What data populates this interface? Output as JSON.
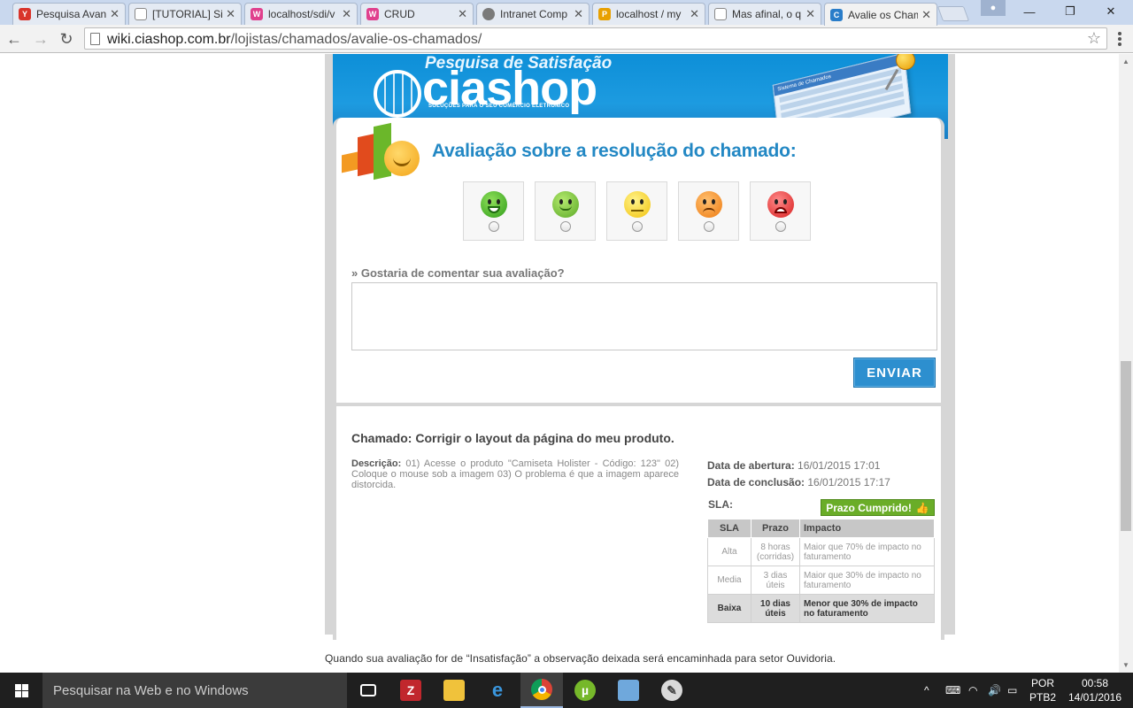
{
  "browser": {
    "tabs": [
      {
        "label": "Pesquisa Avan",
        "favicon_color": "#d9342b",
        "favicon_glyph": "Y"
      },
      {
        "label": "[TUTORIAL] Sis",
        "favicon_color": "#8a8a8a",
        "favicon_glyph": ""
      },
      {
        "label": "localhost/sdi/v",
        "favicon_color": "#e0408d",
        "favicon_glyph": "W"
      },
      {
        "label": "CRUD",
        "favicon_color": "#e0408d",
        "favicon_glyph": "W"
      },
      {
        "label": "Intranet Comp",
        "favicon_color": "#7a7a7a",
        "favicon_glyph": ""
      },
      {
        "label": "localhost / my",
        "favicon_color": "#e8a000",
        "favicon_glyph": "P"
      },
      {
        "label": "Mas afinal, o q",
        "favicon_color": "#8a8a8a",
        "favicon_glyph": ""
      },
      {
        "label": "Avalie os Cham",
        "favicon_color": "#2a7dc9",
        "favicon_glyph": "C"
      }
    ],
    "url_host": "wiki.ciashop.com.br",
    "url_path": "/lojistas/chamados/avalie-os-chamados/"
  },
  "page": {
    "banner": {
      "survey_title": "Pesquisa de Satisfação",
      "brand": "ciashop",
      "tagline": "SOLUÇÕES PARA O SEU COMÉRCIO ELETRÔNICO",
      "mock_header": "Sistema de Chamados"
    },
    "title": "Avaliação sobre a resolução do chamado:",
    "ratings": [
      {
        "name": "very-happy",
        "color": "#43b02a"
      },
      {
        "name": "happy",
        "color": "#7cc43a"
      },
      {
        "name": "neutral",
        "color": "#f5c518"
      },
      {
        "name": "unhappy",
        "color": "#f08a1c"
      },
      {
        "name": "very-unhappy",
        "color": "#e53a3a"
      }
    ],
    "comment_label": "» Gostaria de comentar sua avaliação?",
    "comment_value": "",
    "send_label": "ENVIAR",
    "ticket": {
      "title": "Chamado: Corrigir o layout da página do meu produto.",
      "description_label": "Descrição:",
      "description": " 01) Acesse o produto \"Camiseta Holister - Código: 123\" 02) Coloque o mouse sob a imagem 03) O problema é que a imagem aparece distorcida.",
      "opened_label": "Data de abertura:",
      "opened_value": " 16/01/2015 17:01",
      "closed_label": "Data de conclusão:",
      "closed_value": " 16/01/2015 17:17",
      "sla_label": "SLA:",
      "sla_status": "Prazo Cumprido!",
      "sla_table": {
        "headers": [
          "SLA",
          "Prazo",
          "Impacto"
        ],
        "rows": [
          [
            "Alta",
            "8 horas (corridas)",
            "Maior que 70% de impacto no faturamento"
          ],
          [
            "Media",
            "3 dias úteis",
            "Maior que 30% de impacto no faturamento"
          ],
          [
            "Baixa",
            "10 dias úteis",
            "Menor que 30% de impacto no faturamento"
          ]
        ]
      }
    },
    "footer_note": "Quando sua avaliação for de “Insatisfação” a observação deixada será encaminhada para setor Ouvidoria."
  },
  "taskbar": {
    "search_placeholder": "Pesquisar na Web e no Windows",
    "language": "POR",
    "keyboard": "PTB2",
    "time": "00:58",
    "date": "14/01/2016"
  }
}
